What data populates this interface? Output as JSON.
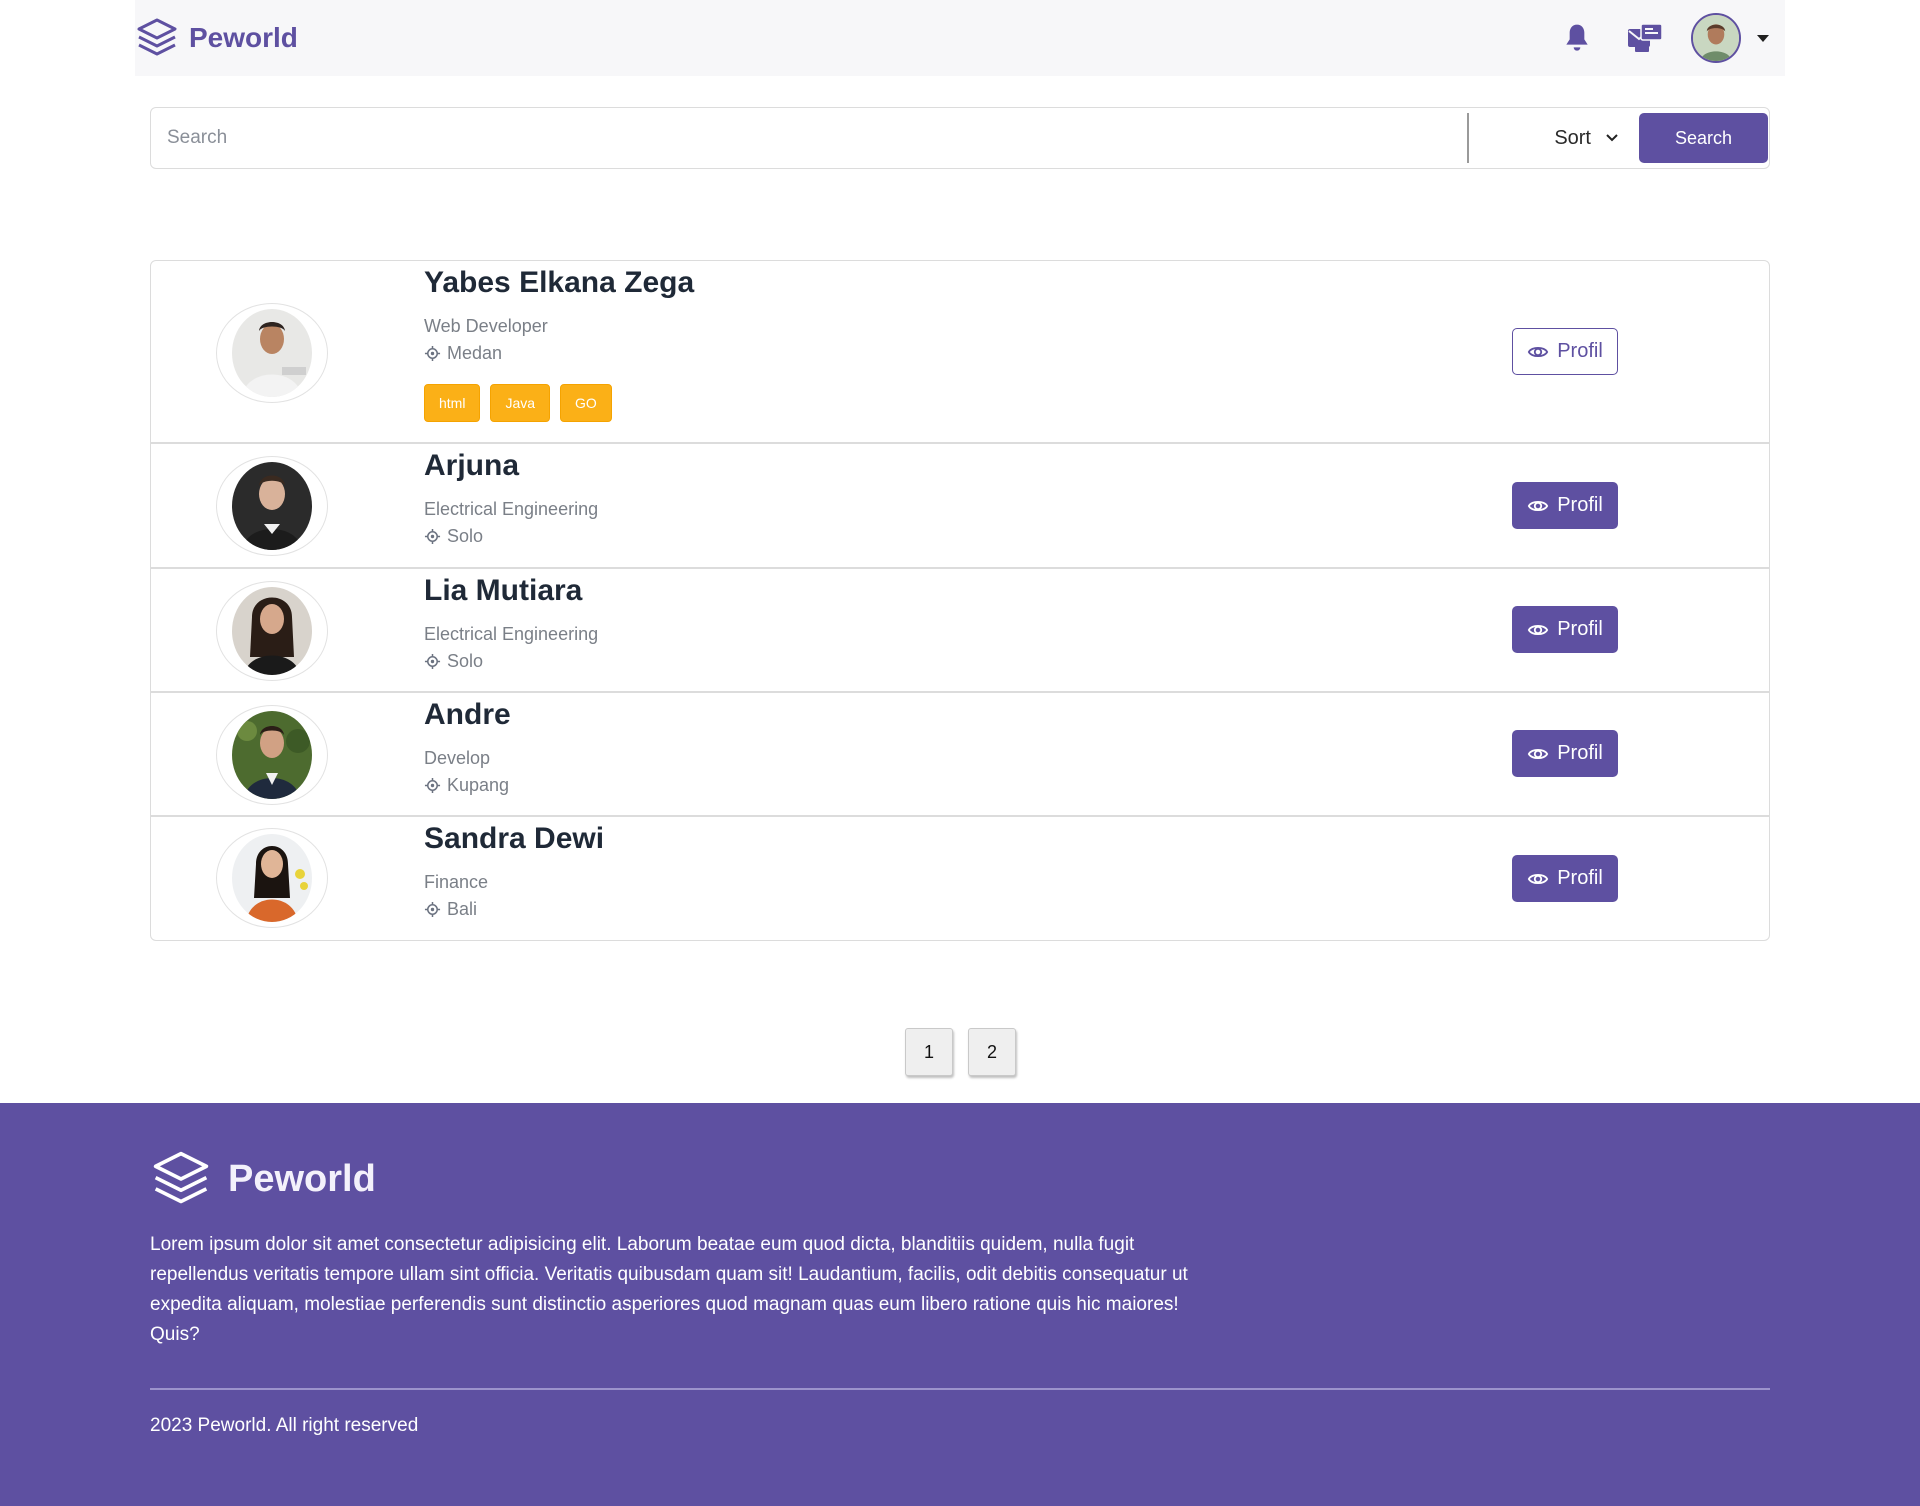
{
  "navbar": {
    "brand": "Peworld",
    "icons": [
      "bell-icon",
      "mail-icon"
    ]
  },
  "search": {
    "placeholder": "Search",
    "sort_label": "Sort",
    "button_label": "Search"
  },
  "workers": [
    {
      "name": "Yabes Elkana Zega",
      "job": "Web Developer",
      "location": "Medan",
      "skills": [
        "html",
        "Java",
        "GO"
      ],
      "button": "Profil",
      "button_style": "outline"
    },
    {
      "name": "Arjuna",
      "job": "Electrical Engineering",
      "location": "Solo",
      "skills": [],
      "button": "Profil",
      "button_style": "filled"
    },
    {
      "name": "Lia Mutiara",
      "job": "Electrical Engineering",
      "location": "Solo",
      "skills": [],
      "button": "Profil",
      "button_style": "filled"
    },
    {
      "name": "Andre",
      "job": "Develop",
      "location": "Kupang",
      "skills": [],
      "button": "Profil",
      "button_style": "filled"
    },
    {
      "name": "Sandra Dewi",
      "job": "Finance",
      "location": "Bali",
      "skills": [],
      "button": "Profil",
      "button_style": "filled"
    }
  ],
  "pagination": {
    "pages": [
      "1",
      "2"
    ]
  },
  "footer": {
    "brand": "Peworld",
    "description": "Lorem ipsum dolor sit amet consectetur adipisicing elit. Laborum beatae eum quod dicta, blanditiis quidem, nulla fugit repellendus veritatis tempore ullam sint officia. Veritatis quibusdam quam sit! Laudantium, facilis, odit debitis consequatur ut expedita aliquam, molestiae perferendis sunt distinctio asperiores quod magnam quas eum libero ratione quis hic maiores! Quis?",
    "copyright": "2023 Peworld. All right reserved"
  },
  "colors": {
    "brand": "#5e50a1",
    "skill": "#fbb017",
    "navbar_bg": "#f7f7f9"
  }
}
